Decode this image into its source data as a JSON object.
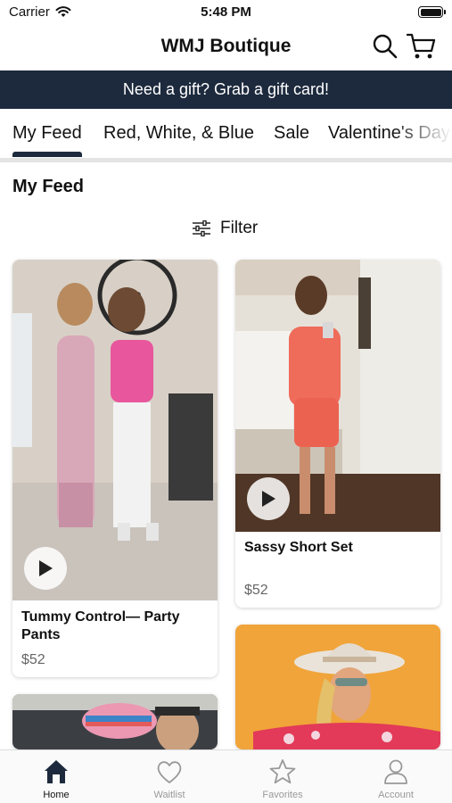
{
  "status_bar": {
    "carrier": "Carrier",
    "time": "5:48 PM"
  },
  "header": {
    "title": "WMJ Boutique"
  },
  "promo_banner": {
    "text": "Need a gift? Grab a gift card!"
  },
  "tabs": [
    {
      "label": "My Feed",
      "active": true
    },
    {
      "label": "Red, White, & Blue"
    },
    {
      "label": "Sale"
    },
    {
      "label": "Valentine's Day"
    }
  ],
  "feed": {
    "title": "My Feed",
    "filter_label": "Filter",
    "products": [
      {
        "name": "Tummy Control— Party Pants",
        "price": "$52",
        "has_video": true
      },
      {
        "name": "Sassy Short Set",
        "price": "$52",
        "has_video": true
      },
      {
        "name": "",
        "price": ""
      },
      {
        "name": "",
        "price": ""
      }
    ]
  },
  "tab_bar": {
    "items": [
      {
        "label": "Home",
        "icon": "home-icon",
        "active": true
      },
      {
        "label": "Waitlist",
        "icon": "heart-icon"
      },
      {
        "label": "Favorites",
        "icon": "star-icon"
      },
      {
        "label": "Account",
        "icon": "account-icon"
      }
    ]
  },
  "colors": {
    "navy": "#1d2a3d",
    "inactive": "#999999"
  }
}
